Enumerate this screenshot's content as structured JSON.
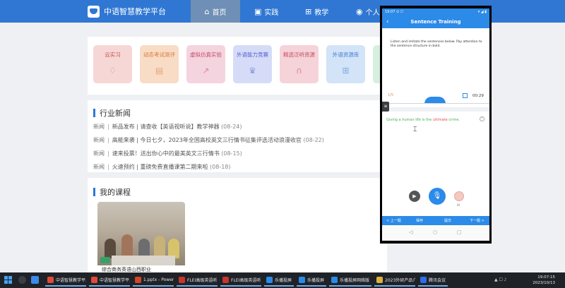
{
  "navbar": {
    "brand": "中语智慧教学平台",
    "items": [
      {
        "label": "首页",
        "icon": "home-icon"
      },
      {
        "label": "实践",
        "icon": "practice-icon"
      },
      {
        "label": "教学",
        "icon": "grid-icon"
      },
      {
        "label": "个人中",
        "icon": "user-icon"
      }
    ]
  },
  "features": [
    {
      "label": "云实习",
      "icon": "bulb-icon",
      "color": "#c0504d"
    },
    {
      "label": "动态考试测评",
      "icon": "document-icon",
      "color": "#d97a39"
    },
    {
      "label": "虚拟仿真实验",
      "icon": "chart-icon",
      "color": "#c24a6d"
    },
    {
      "label": "外语能力竞赛",
      "icon": "trophy-icon",
      "color": "#5461d4"
    },
    {
      "label": "精选泛听资源",
      "icon": "headphones-icon",
      "color": "#c04b5b"
    },
    {
      "label": "外语资源库",
      "icon": "grid-icon",
      "color": "#3f7fcf"
    }
  ],
  "news": {
    "title": "行业新闻",
    "row_label": "新闻",
    "items": [
      {
        "text": "新品发布 | 请查收【英语视听说】教学神器",
        "date": "(08-24)"
      },
      {
        "text": "高能来袭 | 今日七夕，2023年全国高校英文三行情书征集评选活动浪漫收官",
        "date": "(08-22)"
      },
      {
        "text": "速来投票！送出你心中的最美英文三行情书",
        "date": "(08-15)"
      },
      {
        "text": "火速预约 | 重磅免费直播课第二期来啦",
        "date": "(08-18)"
      }
    ]
  },
  "courses": {
    "title": "我的课程",
    "items": [
      {
        "title": "综合商务英语山西职业"
      }
    ]
  },
  "phone": {
    "status_time": "19:07 ⊙ ☐",
    "status_right": "▾ ◢ ▮",
    "header_title": "Sentence Training",
    "back_icon": "‹",
    "instruction": "Listen and imitate the sentences below. Pay attention to the sentence structure in bold.",
    "wave_label": "1/5",
    "timer": "00:29",
    "sentence_pre": "Giving a human life is the ",
    "sentence_hl": "ultimate",
    "sentence_post": " crime.",
    "help": "?",
    "avatar_label": "AI",
    "bottom": {
      "prev": "< 上一题",
      "save": "保存",
      "submit": "提交",
      "next": "下一题 >"
    },
    "nav": {
      "back": "◁",
      "home": "○",
      "recent": "□"
    }
  },
  "taskbar": {
    "apps": [
      {
        "label": "中语智慧教学平...",
        "color": "#e04a3a"
      },
      {
        "label": "中语智慧教学平...",
        "color": "#e04a3a"
      },
      {
        "label": "1.pptx - PowerP...",
        "color": "#d24726"
      },
      {
        "label": "FLEI高级英语听...",
        "color": "#c8352c"
      },
      {
        "label": "FLEI高级英语听...",
        "color": "#c8352c"
      },
      {
        "label": "乐播投屏",
        "color": "#2c8ae8"
      },
      {
        "label": "乐播投屏",
        "color": "#2c8ae8"
      },
      {
        "label": "乐播投屏网络版",
        "color": "#2c8ae8"
      },
      {
        "label": "2023外研产品介...",
        "color": "#e0b040"
      },
      {
        "label": "腾讯会议",
        "color": "#2c6fe8"
      }
    ],
    "time": "19:07:15",
    "date": "2023/10/13"
  }
}
